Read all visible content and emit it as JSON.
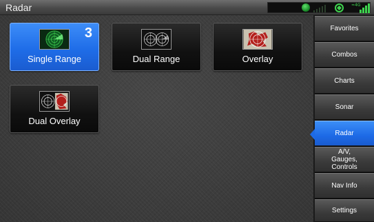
{
  "window": {
    "title": "Radar"
  },
  "status": {
    "signal_label": "≈4G"
  },
  "tiles": [
    {
      "label": "Single Range",
      "badge": "3",
      "icon": "radar-single-range-icon",
      "selected": true
    },
    {
      "label": "Dual Range",
      "icon": "radar-dual-range-icon",
      "selected": false
    },
    {
      "label": "Overlay",
      "icon": "radar-overlay-icon",
      "selected": false
    },
    {
      "label": "Dual Overlay",
      "icon": "radar-dual-overlay-icon",
      "selected": false
    }
  ],
  "sidebar": {
    "items": [
      {
        "label": "Favorites"
      },
      {
        "label": "Combos"
      },
      {
        "label": "Charts"
      },
      {
        "label": "Sonar"
      },
      {
        "label": "Radar",
        "active": true
      },
      {
        "label_lines": [
          "A/V,",
          "Gauges,",
          "Controls"
        ]
      },
      {
        "label": "Nav Info"
      },
      {
        "label": "Settings"
      }
    ]
  },
  "colors": {
    "accent": "#1f6de8",
    "gps_green": "#3fd34f"
  }
}
